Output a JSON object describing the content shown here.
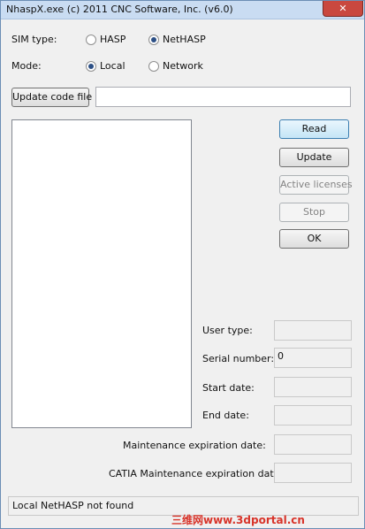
{
  "window": {
    "title": "NhaspX.exe (c) 2011 CNC Software, Inc. (v6.0)",
    "close_glyph": "✕"
  },
  "sim_type": {
    "label": "SIM type:",
    "options": [
      {
        "label": "HASP",
        "selected": false
      },
      {
        "label": "NetHASP",
        "selected": true
      }
    ]
  },
  "mode": {
    "label": "Mode:",
    "options": [
      {
        "label": "Local",
        "selected": true
      },
      {
        "label": "Network",
        "selected": false
      }
    ]
  },
  "update_code_file": {
    "button_label": "Update code file",
    "path_value": ""
  },
  "buttons": {
    "read": "Read",
    "update": "Update",
    "active_licenses": "Active licenses",
    "stop": "Stop",
    "ok": "OK"
  },
  "info": {
    "user_type": {
      "label": "User type:",
      "value": ""
    },
    "serial_number": {
      "label": "Serial number:",
      "value": "0"
    },
    "start_date": {
      "label": "Start date:",
      "value": ""
    },
    "end_date": {
      "label": "End date:",
      "value": ""
    },
    "maintenance_expiration": {
      "label": "Maintenance expiration date:",
      "value": ""
    },
    "catia_maintenance_expiration": {
      "label": "CATIA Maintenance expiration date:",
      "value": ""
    }
  },
  "status_bar": {
    "text": "Local NetHASP not found"
  },
  "watermark": {
    "text": "三维网www.3dportal.cn"
  },
  "colors": {
    "title_bar": "#c9dcf2",
    "close_button": "#c9483f",
    "default_button_border": "#3c7fb1",
    "watermark": "#d8342a"
  }
}
